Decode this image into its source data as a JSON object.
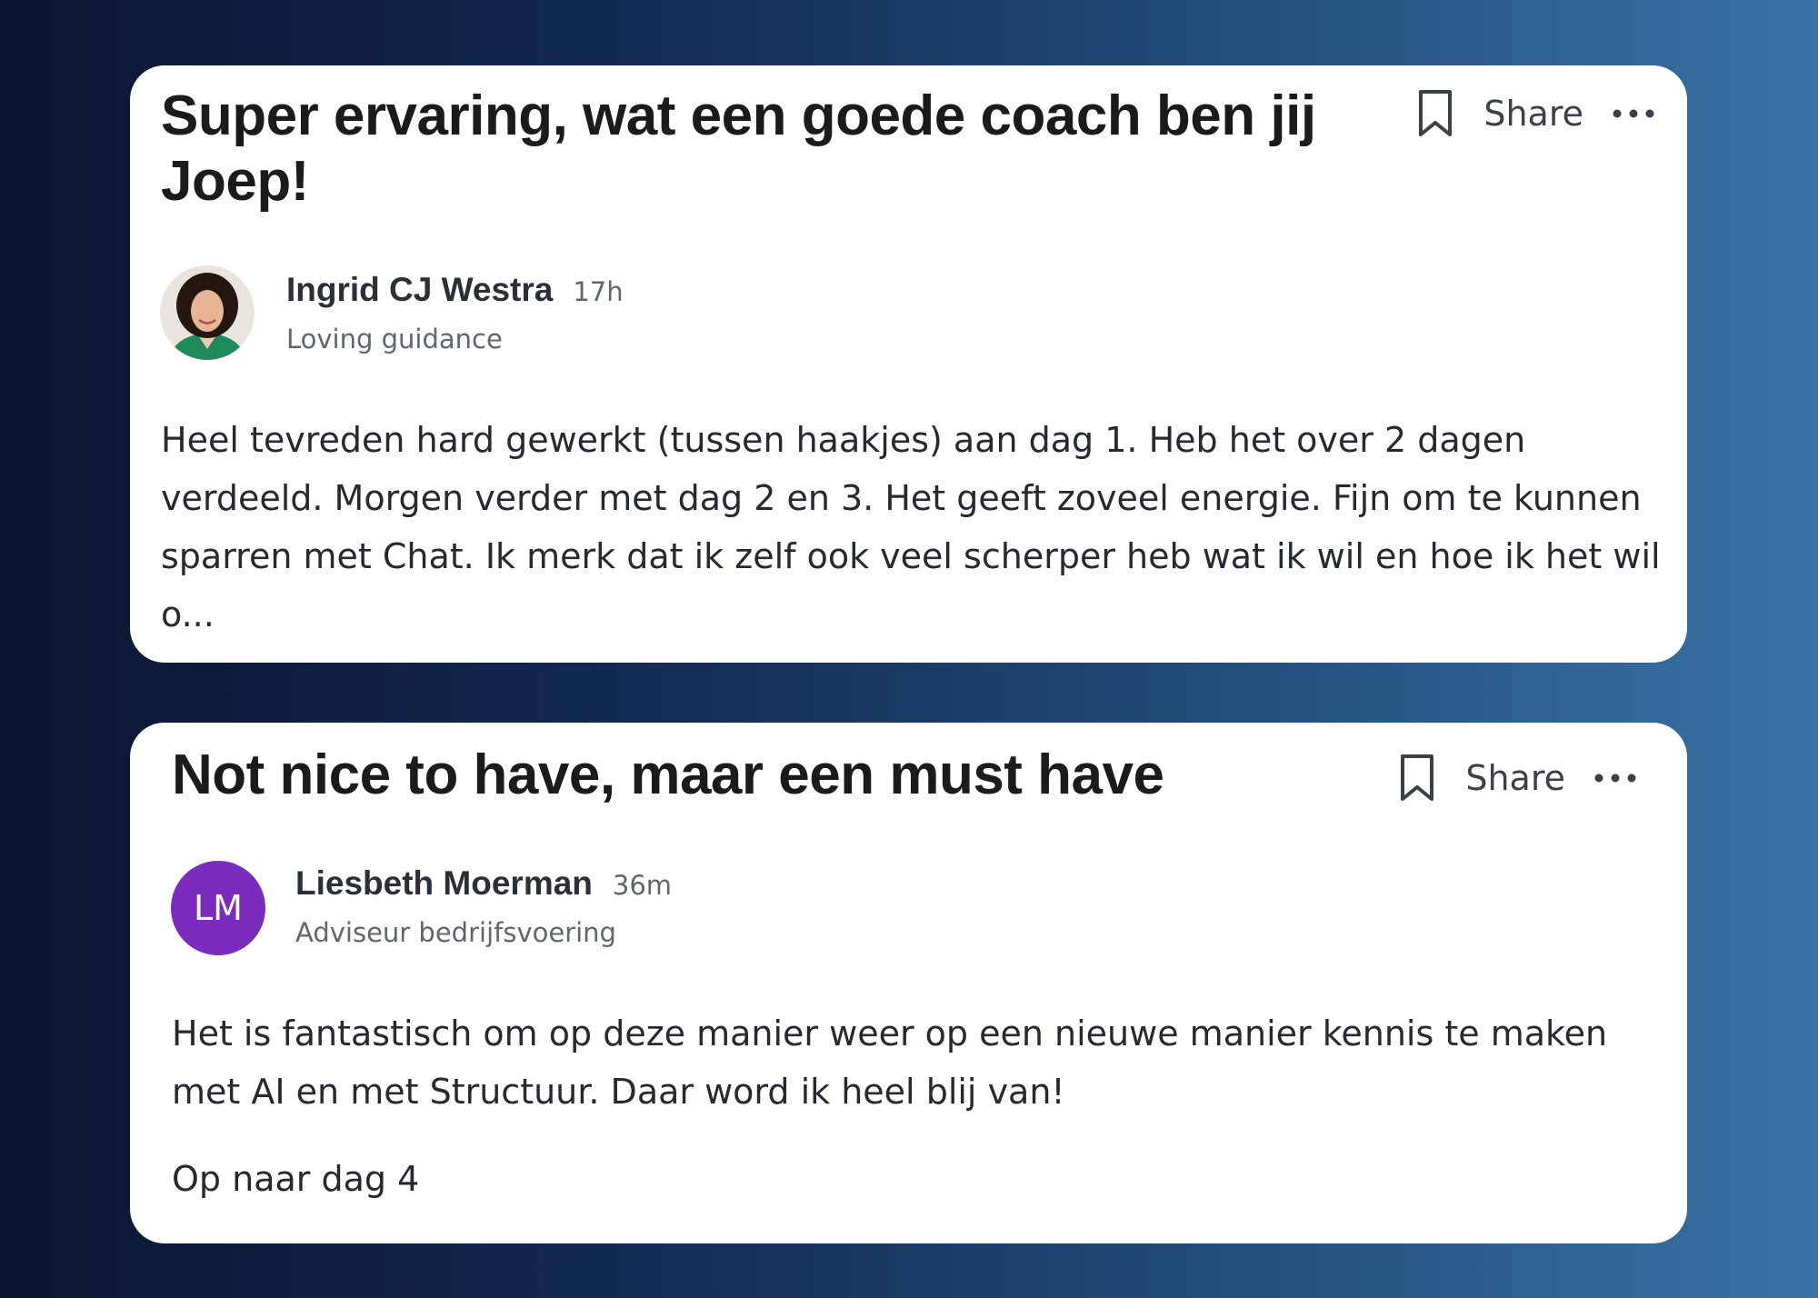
{
  "posts": [
    {
      "title": "Super ervaring, wat een goede coach ben jij Joep!",
      "share_label": "Share",
      "author": {
        "name": "Ingrid CJ Westra",
        "time": "17h",
        "role": "Loving guidance"
      },
      "body": "Heel tevreden hard gewerkt (tussen haakjes) aan dag 1. Heb het over 2 dagen verdeeld. Morgen verder met dag 2 en 3. Het geeft zoveel energie. Fijn om te kunnen sparren met Chat. Ik merk dat ik zelf ook veel scherper heb wat ik wil en hoe ik het wil o..."
    },
    {
      "title": "Not nice to have, maar een must have",
      "share_label": "Share",
      "author": {
        "name": "Liesbeth Moerman",
        "time": "36m",
        "role": "Adviseur bedrijfsvoering",
        "initials": "LM",
        "avatar_color": "#7b2cbf"
      },
      "body": "Het is fantastisch om op deze manier weer op een nieuwe manier kennis te maken met AI en met Structuur. Daar word ik heel blij van!",
      "body_extra": "Op naar dag 4"
    }
  ],
  "icons": {
    "bookmark": "bookmark-icon",
    "more": "more-horizontal-icon"
  }
}
